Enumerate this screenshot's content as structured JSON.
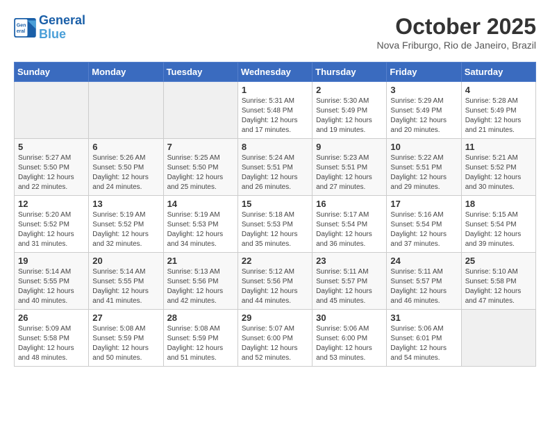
{
  "header": {
    "logo_line1": "General",
    "logo_line2": "Blue",
    "month": "October 2025",
    "location": "Nova Friburgo, Rio de Janeiro, Brazil"
  },
  "weekdays": [
    "Sunday",
    "Monday",
    "Tuesday",
    "Wednesday",
    "Thursday",
    "Friday",
    "Saturday"
  ],
  "weeks": [
    [
      {
        "day": "",
        "info": ""
      },
      {
        "day": "",
        "info": ""
      },
      {
        "day": "",
        "info": ""
      },
      {
        "day": "1",
        "info": "Sunrise: 5:31 AM\nSunset: 5:48 PM\nDaylight: 12 hours\nand 17 minutes."
      },
      {
        "day": "2",
        "info": "Sunrise: 5:30 AM\nSunset: 5:49 PM\nDaylight: 12 hours\nand 19 minutes."
      },
      {
        "day": "3",
        "info": "Sunrise: 5:29 AM\nSunset: 5:49 PM\nDaylight: 12 hours\nand 20 minutes."
      },
      {
        "day": "4",
        "info": "Sunrise: 5:28 AM\nSunset: 5:49 PM\nDaylight: 12 hours\nand 21 minutes."
      }
    ],
    [
      {
        "day": "5",
        "info": "Sunrise: 5:27 AM\nSunset: 5:50 PM\nDaylight: 12 hours\nand 22 minutes."
      },
      {
        "day": "6",
        "info": "Sunrise: 5:26 AM\nSunset: 5:50 PM\nDaylight: 12 hours\nand 24 minutes."
      },
      {
        "day": "7",
        "info": "Sunrise: 5:25 AM\nSunset: 5:50 PM\nDaylight: 12 hours\nand 25 minutes."
      },
      {
        "day": "8",
        "info": "Sunrise: 5:24 AM\nSunset: 5:51 PM\nDaylight: 12 hours\nand 26 minutes."
      },
      {
        "day": "9",
        "info": "Sunrise: 5:23 AM\nSunset: 5:51 PM\nDaylight: 12 hours\nand 27 minutes."
      },
      {
        "day": "10",
        "info": "Sunrise: 5:22 AM\nSunset: 5:51 PM\nDaylight: 12 hours\nand 29 minutes."
      },
      {
        "day": "11",
        "info": "Sunrise: 5:21 AM\nSunset: 5:52 PM\nDaylight: 12 hours\nand 30 minutes."
      }
    ],
    [
      {
        "day": "12",
        "info": "Sunrise: 5:20 AM\nSunset: 5:52 PM\nDaylight: 12 hours\nand 31 minutes."
      },
      {
        "day": "13",
        "info": "Sunrise: 5:19 AM\nSunset: 5:52 PM\nDaylight: 12 hours\nand 32 minutes."
      },
      {
        "day": "14",
        "info": "Sunrise: 5:19 AM\nSunset: 5:53 PM\nDaylight: 12 hours\nand 34 minutes."
      },
      {
        "day": "15",
        "info": "Sunrise: 5:18 AM\nSunset: 5:53 PM\nDaylight: 12 hours\nand 35 minutes."
      },
      {
        "day": "16",
        "info": "Sunrise: 5:17 AM\nSunset: 5:54 PM\nDaylight: 12 hours\nand 36 minutes."
      },
      {
        "day": "17",
        "info": "Sunrise: 5:16 AM\nSunset: 5:54 PM\nDaylight: 12 hours\nand 37 minutes."
      },
      {
        "day": "18",
        "info": "Sunrise: 5:15 AM\nSunset: 5:54 PM\nDaylight: 12 hours\nand 39 minutes."
      }
    ],
    [
      {
        "day": "19",
        "info": "Sunrise: 5:14 AM\nSunset: 5:55 PM\nDaylight: 12 hours\nand 40 minutes."
      },
      {
        "day": "20",
        "info": "Sunrise: 5:14 AM\nSunset: 5:55 PM\nDaylight: 12 hours\nand 41 minutes."
      },
      {
        "day": "21",
        "info": "Sunrise: 5:13 AM\nSunset: 5:56 PM\nDaylight: 12 hours\nand 42 minutes."
      },
      {
        "day": "22",
        "info": "Sunrise: 5:12 AM\nSunset: 5:56 PM\nDaylight: 12 hours\nand 44 minutes."
      },
      {
        "day": "23",
        "info": "Sunrise: 5:11 AM\nSunset: 5:57 PM\nDaylight: 12 hours\nand 45 minutes."
      },
      {
        "day": "24",
        "info": "Sunrise: 5:11 AM\nSunset: 5:57 PM\nDaylight: 12 hours\nand 46 minutes."
      },
      {
        "day": "25",
        "info": "Sunrise: 5:10 AM\nSunset: 5:58 PM\nDaylight: 12 hours\nand 47 minutes."
      }
    ],
    [
      {
        "day": "26",
        "info": "Sunrise: 5:09 AM\nSunset: 5:58 PM\nDaylight: 12 hours\nand 48 minutes."
      },
      {
        "day": "27",
        "info": "Sunrise: 5:08 AM\nSunset: 5:59 PM\nDaylight: 12 hours\nand 50 minutes."
      },
      {
        "day": "28",
        "info": "Sunrise: 5:08 AM\nSunset: 5:59 PM\nDaylight: 12 hours\nand 51 minutes."
      },
      {
        "day": "29",
        "info": "Sunrise: 5:07 AM\nSunset: 6:00 PM\nDaylight: 12 hours\nand 52 minutes."
      },
      {
        "day": "30",
        "info": "Sunrise: 5:06 AM\nSunset: 6:00 PM\nDaylight: 12 hours\nand 53 minutes."
      },
      {
        "day": "31",
        "info": "Sunrise: 5:06 AM\nSunset: 6:01 PM\nDaylight: 12 hours\nand 54 minutes."
      },
      {
        "day": "",
        "info": ""
      }
    ]
  ]
}
